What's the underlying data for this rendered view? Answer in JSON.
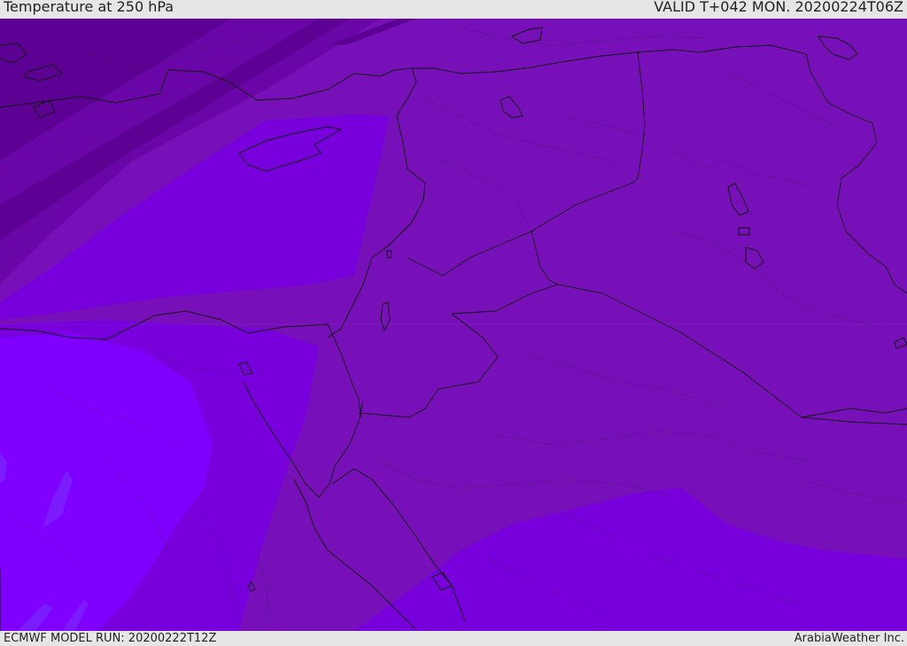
{
  "header": {
    "title": "Temperature at 250 hPa",
    "valid_time": "VALID T+042 MON. 20200224T06Z"
  },
  "footer": {
    "model_run": "ECMWF MODEL RUN: 20200222T12Z",
    "credit": "ArabiaWeather Inc."
  },
  "map": {
    "field": "temperature-250hPa",
    "region": "eastern-mediterranean-middle-east",
    "colors": {
      "band_coldest": "#5c0194",
      "band_cold": "#6a05a8",
      "band_mid": "#7710b8",
      "band_warm": "#7800dc",
      "band_warmer": "#8000ff",
      "band_warmest": "#7a1cff",
      "coastline": "#111111"
    }
  }
}
